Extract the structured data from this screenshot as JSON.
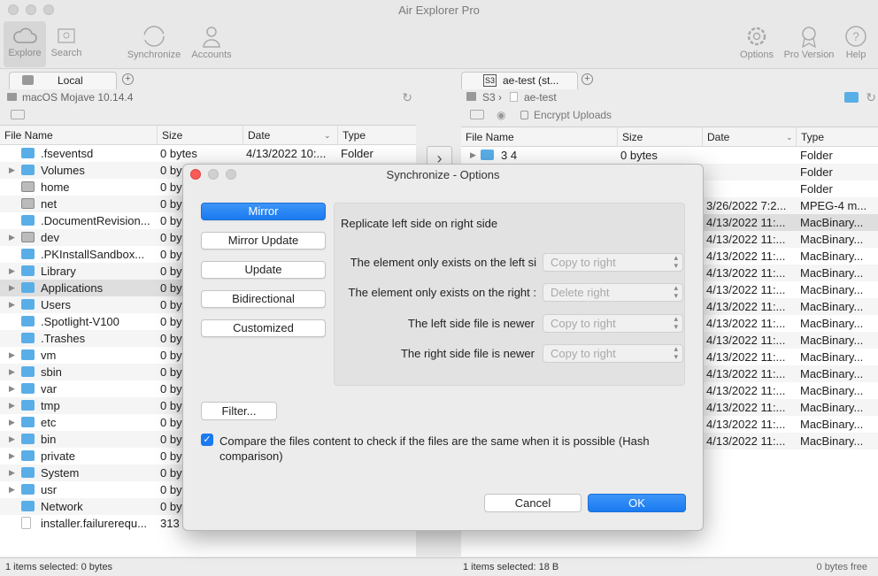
{
  "window": {
    "title": "Air Explorer Pro"
  },
  "toolbar": {
    "explore": "Explore",
    "search": "Search",
    "synchronize": "Synchronize",
    "accounts": "Accounts",
    "options": "Options",
    "pro_version": "Pro Version",
    "help": "Help"
  },
  "left": {
    "tab": "Local",
    "path": "macOS Mojave 10.14.4",
    "columns": {
      "name": "File Name",
      "size": "Size",
      "date": "Date",
      "type": "Type"
    },
    "rows": [
      {
        "name": ".fseventsd",
        "size": "0 bytes",
        "date": "4/13/2022 10:...",
        "type": "Folder"
      },
      {
        "name": "Volumes",
        "size": "0 by"
      },
      {
        "name": "home",
        "size": "0 by"
      },
      {
        "name": "net",
        "size": "0 by"
      },
      {
        "name": ".DocumentRevision...",
        "size": "0 by"
      },
      {
        "name": "dev",
        "size": "0 by"
      },
      {
        "name": ".PKInstallSandbox...",
        "size": "0 by"
      },
      {
        "name": "Library",
        "size": "0 by"
      },
      {
        "name": "Applications",
        "size": "0 by"
      },
      {
        "name": "Users",
        "size": "0 by"
      },
      {
        "name": ".Spotlight-V100",
        "size": "0 by"
      },
      {
        "name": ".Trashes",
        "size": "0 by"
      },
      {
        "name": "vm",
        "size": "0 by"
      },
      {
        "name": "sbin",
        "size": "0 by"
      },
      {
        "name": "var",
        "size": "0 by"
      },
      {
        "name": "tmp",
        "size": "0 by"
      },
      {
        "name": "etc",
        "size": "0 by"
      },
      {
        "name": "bin",
        "size": "0 by"
      },
      {
        "name": "private",
        "size": "0 by"
      },
      {
        "name": "System",
        "size": "0 by"
      },
      {
        "name": "usr",
        "size": "0 by"
      },
      {
        "name": "Network",
        "size": "0 by"
      },
      {
        "name": "installer.failurerequ...",
        "size": "313"
      }
    ],
    "status": "1 items selected: 0 bytes"
  },
  "right": {
    "tab": "ae-test (st...",
    "tab_badge": "S3",
    "path_root": "S3",
    "path_sep": "›",
    "path_folder": "ae-test",
    "encrypt_uploads": "Encrypt Uploads",
    "columns": {
      "name": "File Name",
      "size": "Size",
      "date": "Date",
      "type": "Type"
    },
    "rows": [
      {
        "name": "3 4",
        "size": "0 bytes",
        "date": "",
        "type": "Folder"
      },
      {
        "date": "",
        "type": "Folder"
      },
      {
        "date": "",
        "type": "Folder"
      },
      {
        "date": "3/26/2022 7:2...",
        "type": "MPEG-4 m..."
      },
      {
        "date": "4/13/2022 11:...",
        "type": "MacBinary..."
      },
      {
        "date": "4/13/2022 11:...",
        "type": "MacBinary..."
      },
      {
        "date": "4/13/2022 11:...",
        "type": "MacBinary..."
      },
      {
        "date": "4/13/2022 11:...",
        "type": "MacBinary..."
      },
      {
        "date": "4/13/2022 11:...",
        "type": "MacBinary..."
      },
      {
        "date": "4/13/2022 11:...",
        "type": "MacBinary..."
      },
      {
        "date": "4/13/2022 11:...",
        "type": "MacBinary..."
      },
      {
        "date": "4/13/2022 11:...",
        "type": "MacBinary..."
      },
      {
        "date": "4/13/2022 11:...",
        "type": "MacBinary..."
      },
      {
        "date": "4/13/2022 11:...",
        "type": "MacBinary..."
      },
      {
        "date": "4/13/2022 11:...",
        "type": "MacBinary..."
      },
      {
        "date": "4/13/2022 11:...",
        "type": "MacBinary..."
      },
      {
        "date": "4/13/2022 11:...",
        "type": "MacBinary..."
      },
      {
        "date": "4/13/2022 11:...",
        "type": "MacBinary..."
      }
    ],
    "status": "1 items selected: 18 B",
    "free": "0 bytes free"
  },
  "dialog": {
    "title": "Synchronize - Options",
    "modes": [
      "Mirror",
      "Mirror Update",
      "Update",
      "Bidirectional",
      "Customized"
    ],
    "description": "Replicate left side on right side",
    "options": [
      {
        "label": "The element only exists on the left si",
        "value": "Copy to right"
      },
      {
        "label": "The element only exists on the right :",
        "value": "Delete right"
      },
      {
        "label": "The left side file is newer",
        "value": "Copy to right"
      },
      {
        "label": "The right side file is newer",
        "value": "Copy to right"
      }
    ],
    "filter": "Filter...",
    "compare_line1": "Compare the files content to check if the files are the same when it is possible (Hash",
    "compare_line2": "comparison)",
    "cancel": "Cancel",
    "ok": "OK"
  },
  "colors": {
    "accent": "#1a7af0",
    "folder": "#5aaee8"
  }
}
